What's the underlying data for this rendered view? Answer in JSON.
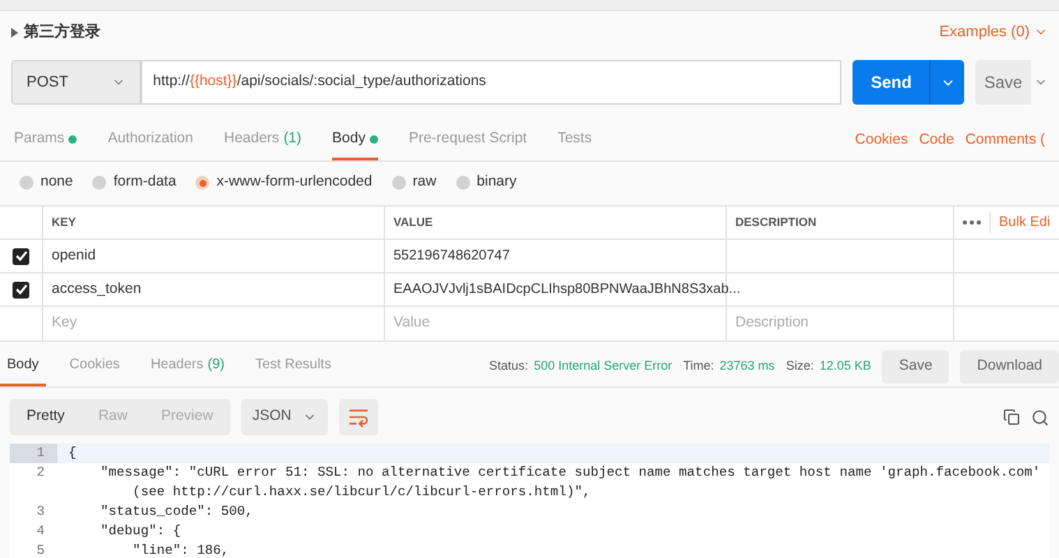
{
  "request_name": "第三方登录",
  "examples": "Examples (0)",
  "url_bar": {
    "method": "POST",
    "url_parts": [
      {
        "kind": "plain",
        "text": "http://"
      },
      {
        "kind": "variable",
        "text": "{{host}}"
      },
      {
        "kind": "plain",
        "text": "/api/socials/:social_type/authorizations"
      }
    ],
    "send": "Send",
    "save": "Save"
  },
  "request_tabs": [
    {
      "label": "Params",
      "dot": true,
      "selected": false
    },
    {
      "label": "Authorization",
      "dot": false,
      "selected": false
    },
    {
      "label": "Headers",
      "count": "(1)",
      "dot": false,
      "selected": false
    },
    {
      "label": "Body",
      "dot": true,
      "selected": true
    },
    {
      "label": "Pre-request Script",
      "dot": false,
      "selected": false
    },
    {
      "label": "Tests",
      "dot": false,
      "selected": false
    }
  ],
  "request_links": [
    "Cookies",
    "Code",
    "Comments ("
  ],
  "body_types": [
    {
      "label": "none",
      "selected": false
    },
    {
      "label": "form-data",
      "selected": false
    },
    {
      "label": "x-www-form-urlencoded",
      "selected": true
    },
    {
      "label": "raw",
      "selected": false
    },
    {
      "label": "binary",
      "selected": false
    }
  ],
  "params_table": {
    "columns": [
      "KEY",
      "VALUE",
      "DESCRIPTION"
    ],
    "bulk_edit": "Bulk Edi",
    "rows": [
      {
        "key": "openid",
        "value": "552196748620747",
        "checked": true
      },
      {
        "key": "access_token",
        "value": "EAAOJVJvlj1sBAIDcpCLIhsp80BPNWaaJBhN8S3xab...",
        "checked": true
      }
    ],
    "new_row": {
      "key_placeholder": "Key",
      "value_placeholder": "Value",
      "description_placeholder": "Description"
    }
  },
  "response": {
    "tabs": [
      {
        "label": "Body",
        "selected": true
      },
      {
        "label": "Cookies",
        "selected": false
      },
      {
        "label": "Headers",
        "count": "(9)",
        "selected": false
      },
      {
        "label": "Test Results",
        "selected": false
      }
    ],
    "stats": [
      {
        "label": "Status:",
        "value": "500 Internal Server Error"
      },
      {
        "label": "Time:",
        "value": "23763 ms"
      },
      {
        "label": "Size:",
        "value": "12.05 KB"
      }
    ],
    "buttons": [
      "Save",
      "Download"
    ],
    "view_modes": [
      {
        "label": "Pretty",
        "selected": true
      },
      {
        "label": "Raw",
        "selected": false
      },
      {
        "label": "Preview",
        "selected": false
      }
    ],
    "format": "JSON",
    "code_lines": [
      {
        "number": "1",
        "text": "{",
        "current": true
      },
      {
        "number": "2",
        "text": "    \"message\": \"cURL error 51: SSL: no alternative certificate subject name matches target host name 'graph.facebook.com'",
        "continuation": "        (see http://curl.haxx.se/libcurl/c/libcurl-errors.html)\",",
        "current": false
      },
      {
        "number": "3",
        "text": "    \"status_code\": 500,",
        "current": false
      },
      {
        "number": "4",
        "text": "    \"debug\": {",
        "current": false
      },
      {
        "number": "5",
        "text": "        \"line\": 186,",
        "current": false
      }
    ]
  }
}
